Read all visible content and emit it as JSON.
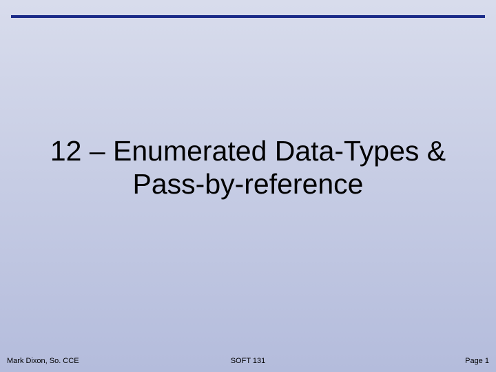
{
  "slide": {
    "title_line1": "12 – Enumerated Data-Types &",
    "title_line2": "Pass-by-reference"
  },
  "footer": {
    "left": "Mark Dixon, So. CCE",
    "center": "SOFT 131",
    "right": "Page 1"
  }
}
